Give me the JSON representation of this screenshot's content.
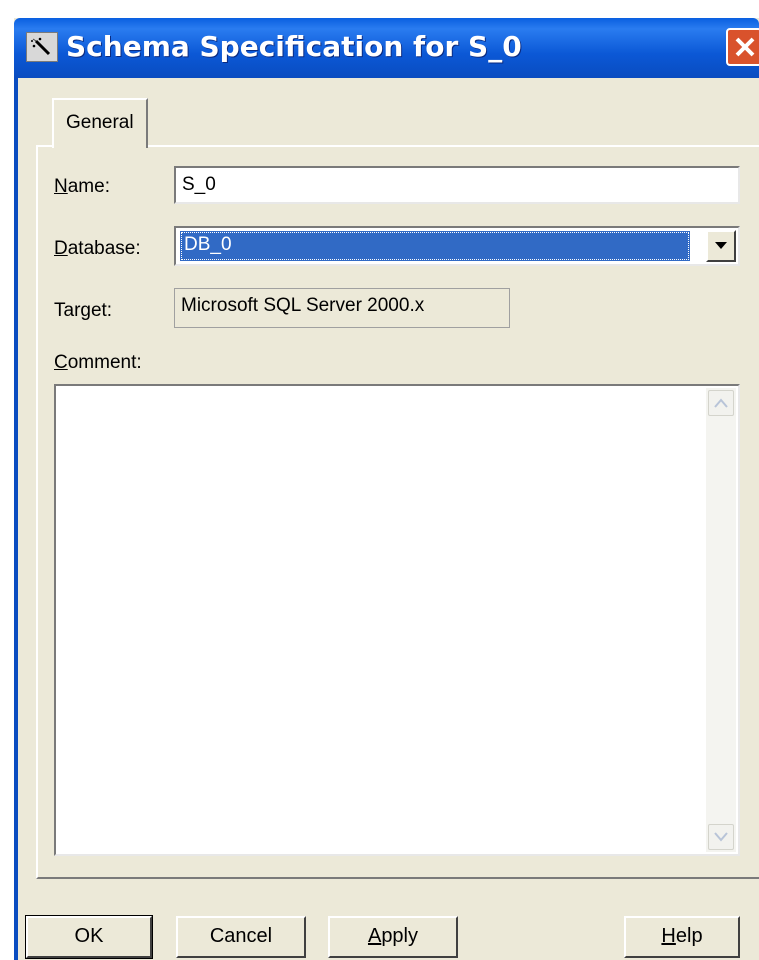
{
  "window": {
    "title": "Schema Specification for S_0",
    "colors": {
      "titlebar": "#0a5fe0",
      "face": "#ece9d8",
      "close": "#d9522c",
      "selection": "#316ac5"
    }
  },
  "tabs": [
    {
      "label": "General",
      "active": true
    }
  ],
  "form": {
    "name_label_key": "N",
    "name_label_rest": "ame:",
    "name_value": "S_0",
    "database_label_key": "D",
    "database_label_rest": "atabase:",
    "database_value": "DB_0",
    "target_label": "Target:",
    "target_value": "Microsoft SQL Server 2000.x",
    "comment_label_key": "C",
    "comment_label_rest": "omment:",
    "comment_value": ""
  },
  "buttons": {
    "ok": "OK",
    "cancel": "Cancel",
    "apply_key": "A",
    "apply_rest": "pply",
    "help_key": "H",
    "help_rest": "elp"
  },
  "icons": {
    "title": "schema-wand-icon",
    "close": "close-icon",
    "dropdown": "chevron-down-icon",
    "scroll_up": "scroll-up-arrow-icon",
    "scroll_down": "scroll-down-arrow-icon"
  }
}
